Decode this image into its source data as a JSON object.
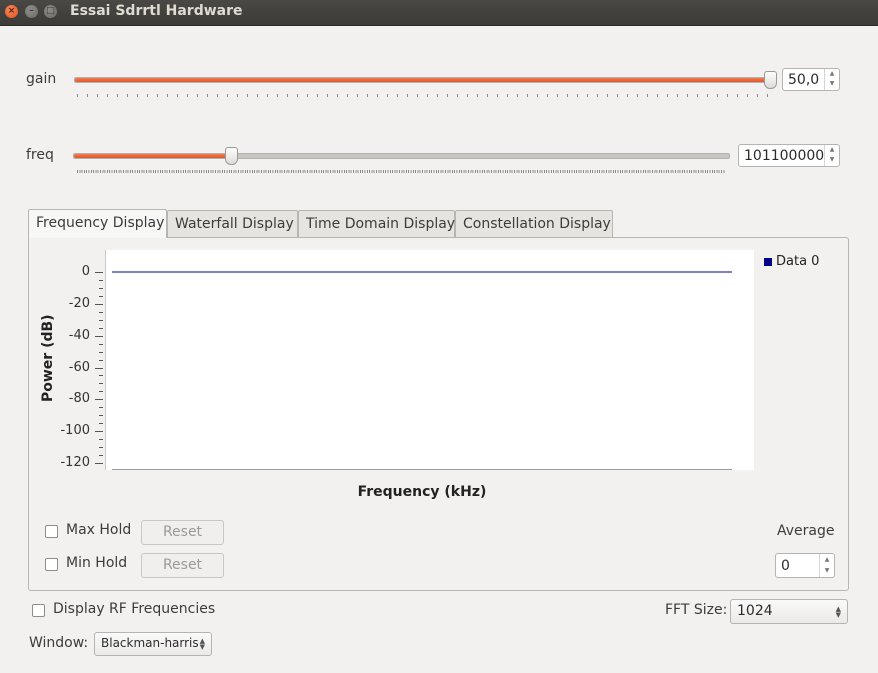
{
  "window": {
    "title": "Essai Sdrrtl Hardware"
  },
  "gain": {
    "label": "gain",
    "value": "50,0",
    "level_fraction": 1.0
  },
  "freq": {
    "label": "freq",
    "value": "101100000",
    "level_fraction": 0.24
  },
  "tabs": [
    {
      "label": "Frequency Display",
      "active": true
    },
    {
      "label": "Waterfall Display",
      "active": false
    },
    {
      "label": "Time Domain Display",
      "active": false
    },
    {
      "label": "Constellation Display",
      "active": false
    }
  ],
  "chart_data": {
    "type": "line",
    "xlabel": "Frequency (kHz)",
    "ylabel": "Power (dB)",
    "ylim": [
      -120,
      0
    ],
    "yticks": [
      "0",
      "-20",
      "-40",
      "-60",
      "-80",
      "-100",
      "-120"
    ],
    "grid": false,
    "legend_position": "top-right",
    "series": [
      {
        "name": "Data 0",
        "color": "#00008b",
        "y_constant": 0
      }
    ]
  },
  "controls": {
    "max_hold": {
      "label": "Max Hold",
      "checked": false,
      "reset_label": "Reset"
    },
    "min_hold": {
      "label": "Min Hold",
      "checked": false,
      "reset_label": "Reset"
    },
    "average": {
      "label": "Average",
      "value": "0"
    },
    "display_rf": {
      "label": "Display RF Frequencies",
      "checked": false
    },
    "fft_size": {
      "label": "FFT Size:",
      "value": "1024"
    },
    "window": {
      "label": "Window:",
      "value": "Blackman-harris"
    }
  },
  "colors": {
    "accent": "#e95420",
    "series": "#00008b"
  }
}
